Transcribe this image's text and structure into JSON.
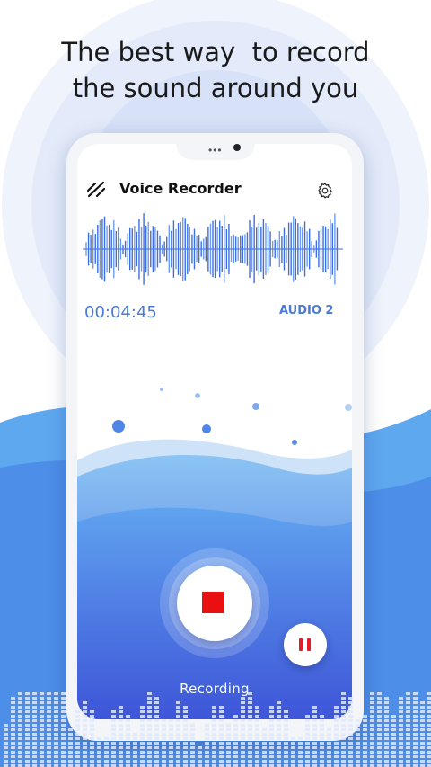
{
  "headline": {
    "line1": "The best way  to record",
    "line2": "the sound around you"
  },
  "app": {
    "title": "Voice Recorder",
    "menu_icon": "menu-slash-icon",
    "settings_icon": "gear-icon"
  },
  "recording": {
    "timer": "00:04:45",
    "file_name": "AUDIO 2",
    "status": "Recording",
    "stop_icon": "stop-icon",
    "pause_icon": "pause-icon"
  },
  "colors": {
    "accent": "#4a7ad6",
    "stop_red": "#e81010",
    "wave_blue": "#3d6fe0"
  }
}
